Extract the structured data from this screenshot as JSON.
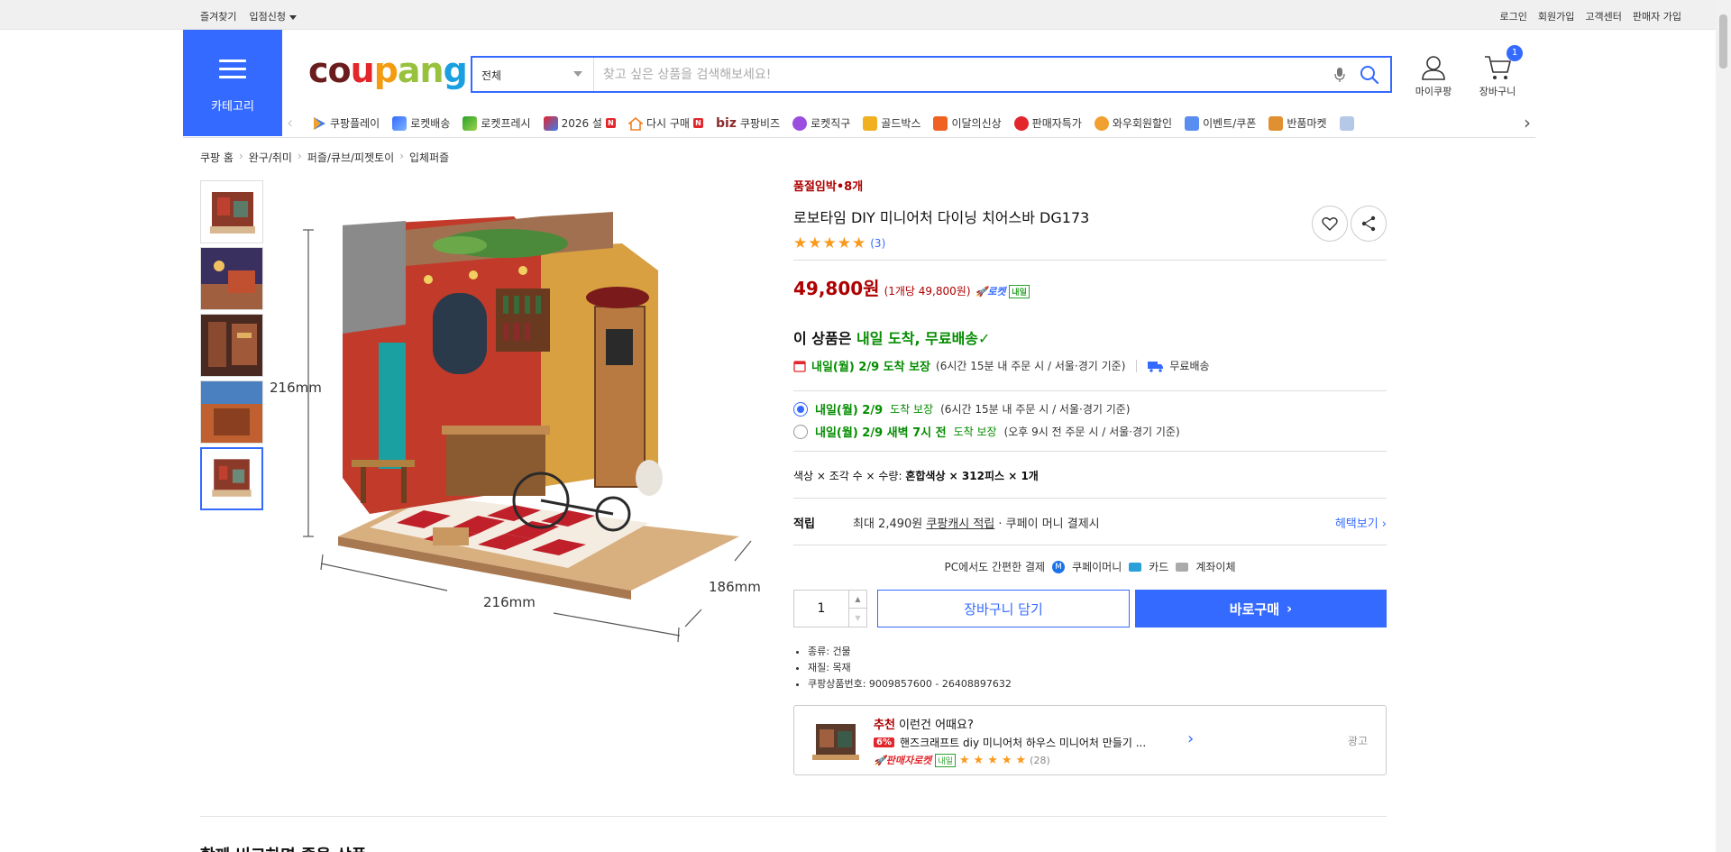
{
  "topbar": {
    "favorites": "즐겨찾기",
    "seller_apply": "입점신청",
    "login": "로그인",
    "signup": "회원가입",
    "customer_center": "고객센터",
    "seller_signup": "판매자 가입"
  },
  "header": {
    "category_label": "카테고리",
    "logo": {
      "c1": "co",
      "c2": "u",
      "c3": "p",
      "c4": "an",
      "c5": "g"
    },
    "search_category": "전체",
    "search_placeholder": "찾고 싶은 상품을 검색해보세요!",
    "my_coupang": "마이쿠팡",
    "cart": "장바구니",
    "cart_count": "1"
  },
  "nav": {
    "items": [
      {
        "label": "쿠팡플레이"
      },
      {
        "label": "로켓배송"
      },
      {
        "label": "로켓프레시"
      },
      {
        "label": "2026 설"
      },
      {
        "label": "다시 구매"
      },
      {
        "label": "쿠팡비즈",
        "prefix": "biz"
      },
      {
        "label": "로켓직구"
      },
      {
        "label": "골드박스"
      },
      {
        "label": "이달의신상"
      },
      {
        "label": "판매자특가"
      },
      {
        "label": "와우회원할인"
      },
      {
        "label": "이벤트/쿠폰"
      },
      {
        "label": "반품마켓"
      }
    ],
    "new_badge": "N"
  },
  "breadcrumb": [
    "쿠팡 홈",
    "완구/취미",
    "퍼즐/큐브/피젯토이",
    "입체퍼즐"
  ],
  "gallery": {
    "dim_height": "216mm",
    "dim_width": "216mm",
    "dim_depth": "186mm"
  },
  "product": {
    "stock_notice": "품절임박•8개",
    "title": "로보타임 DIY 미니어처 다이닝 치어스바 DG173",
    "rating": 5,
    "review_count": "(3)",
    "price": "49,800원",
    "unit_price": "(1개당 49,800원)",
    "rocket_label": "로켓",
    "rocket_tag": "내일",
    "delivery_head_prefix": "이 상품은 ",
    "delivery_head_green": "내일 도착, 무료배송",
    "delivery_date": "내일(월) 2/9 도착 보장",
    "delivery_cond": "(6시간 15분 내 주문 시 / 서울·경기 기준)",
    "free_shipping": "무료배송",
    "options": [
      {
        "date": "내일(월) 2/9",
        "label": "도착 보장",
        "cond": "(6시간 15분 내 주문 시 / 서울·경기 기준)",
        "checked": true
      },
      {
        "date": "내일(월) 2/9 새벽 7시 전",
        "label": "도착 보장",
        "cond": "(오후 9시 전 주문 시 / 서울·경기 기준)",
        "checked": false
      }
    ],
    "option_prefix": "색상 × 조각 수 × 수량: ",
    "option_value": "혼합색상 × 312피스 × 1개",
    "reward_label": "적립",
    "reward_prefix": "최대 2,490원 ",
    "reward_link": "쿠팡캐시 적립",
    "reward_suffix": " · 쿠페이 머니 결제시",
    "benefit_link": "헤택보기 ›",
    "pay_title": "PC에서도 간편한 결제",
    "pay_coupay": "쿠페이머니",
    "pay_card": "카드",
    "pay_bank": "계좌이체",
    "quantity": "1",
    "add_to_cart": "장바구니 담기",
    "buy_now": "바로구매",
    "attributes": [
      "종류: 건물",
      "재질: 목재",
      "쿠팡상품번호: 9009857600 - 26408897632"
    ]
  },
  "recommend": {
    "title_red": "추천",
    "title_rest": " 이런건 어때요?",
    "discount": "6%",
    "name": "핸즈크래프트 diy 미니어처 하우스 미니어처 만들기 ...",
    "rocket": "판매자로켓",
    "rocket_tag": "내일",
    "review_count": "(28)",
    "ad_label": "광고"
  },
  "section": {
    "title": "함께 비교하면 좋을 상품"
  },
  "colors": {
    "brand_blue": "#346aff",
    "price_red": "#ae0000",
    "delivery_green": "#048d00",
    "star_orange": "#f99a1c"
  }
}
